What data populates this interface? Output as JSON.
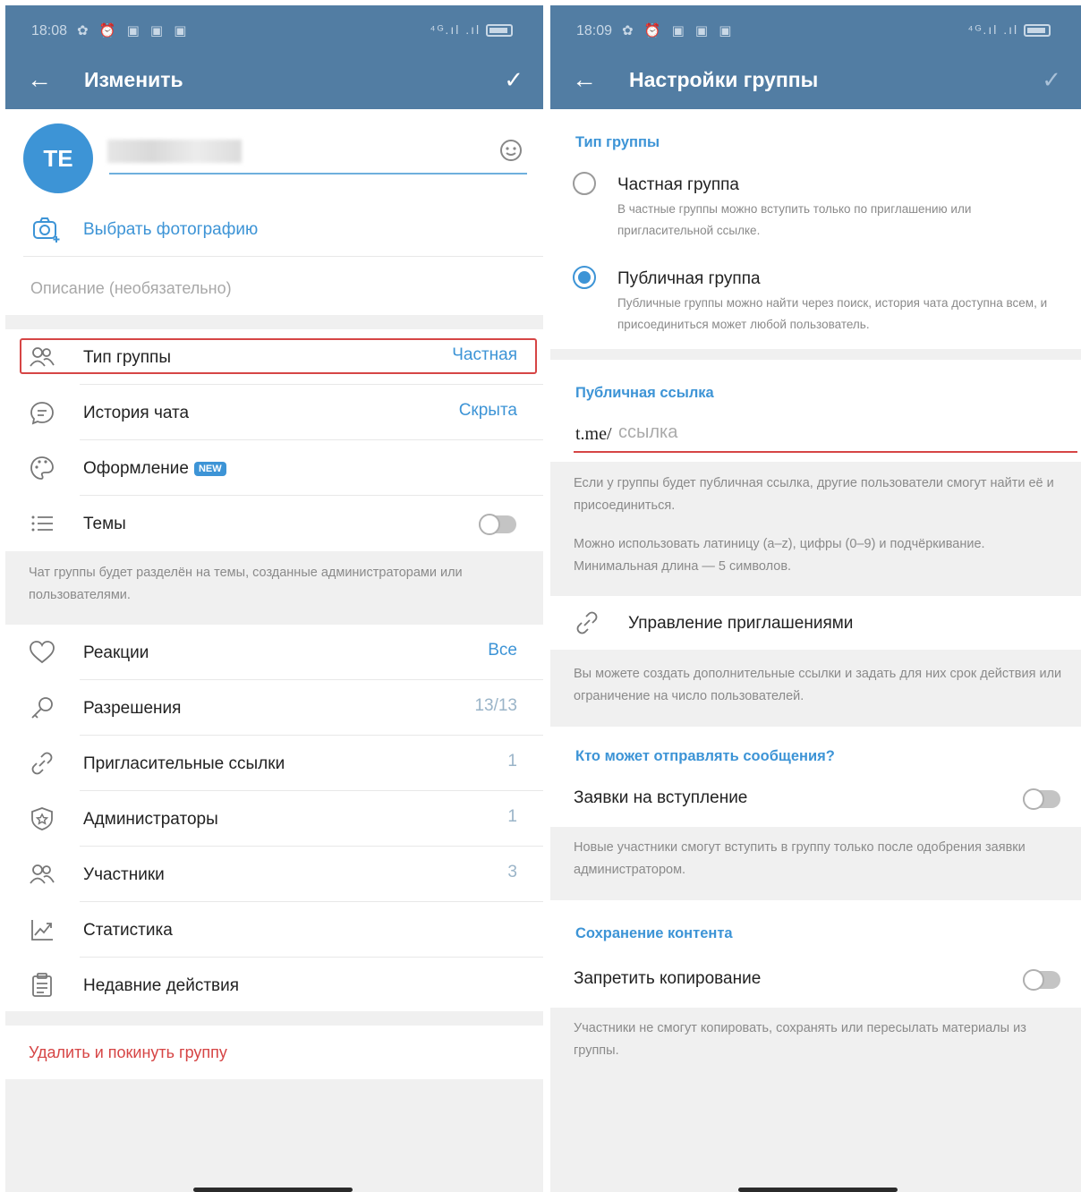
{
  "left": {
    "status": {
      "time": "18:08",
      "icons": "✿ ⏰ ▣ ▣ ▣",
      "signal": "⁴ᴳ.ıl .ıl"
    },
    "appbar": {
      "back": "←",
      "title": "Изменить",
      "check": "✓"
    },
    "avatar_initials": "TE",
    "choose_photo": "Выбрать фотографию",
    "description_placeholder": "Описание (необязательно)",
    "settings": [
      {
        "label": "Тип группы",
        "value": "Частная",
        "icon": "users-icon"
      },
      {
        "label": "История чата",
        "value": "Скрыта",
        "icon": "chat-bubble-icon"
      },
      {
        "label": "Оформление",
        "badge": "NEW",
        "icon": "palette-icon"
      },
      {
        "label": "Темы",
        "icon": "list-icon",
        "toggle": false
      }
    ],
    "topics_hint": "Чат группы будет разделён на темы, созданные администраторами или пользователями.",
    "manage": [
      {
        "label": "Реакции",
        "value": "Все",
        "icon": "heart-icon"
      },
      {
        "label": "Разрешения",
        "value": "13/13",
        "icon": "key-icon"
      },
      {
        "label": "Пригласительные ссылки",
        "value": "1",
        "icon": "link-icon"
      },
      {
        "label": "Администраторы",
        "value": "1",
        "icon": "shield-icon"
      },
      {
        "label": "Участники",
        "value": "3",
        "icon": "users-icon"
      },
      {
        "label": "Статистика",
        "icon": "chart-icon"
      },
      {
        "label": "Недавние действия",
        "icon": "clipboard-icon"
      }
    ],
    "delete_label": "Удалить и покинуть группу"
  },
  "right": {
    "status": {
      "time": "18:09",
      "icons": "✿ ⏰ ▣ ▣ ▣",
      "signal": "⁴ᴳ.ıl .ıl"
    },
    "appbar": {
      "back": "←",
      "title": "Настройки группы",
      "check": "✓"
    },
    "type_section": "Тип группы",
    "private": {
      "label": "Частная группа",
      "desc": "В частные группы можно вступить только по приглашению или пригласительной ссылке."
    },
    "public": {
      "label": "Публичная группа",
      "desc": "Публичные группы можно найти через поиск, история чата доступна всем, и присоединиться может любой пользователь."
    },
    "public_link_section": "Публичная ссылка",
    "link_prefix": "t.me/",
    "link_placeholder": "ссылка",
    "link_hint1": "Если у группы будет публичная ссылка, другие пользователи смогут найти её и присоединиться.",
    "link_hint2": "Можно использовать латиницу (a–z), цифры (0–9) и подчёркивание. Минимальная длина — 5 символов.",
    "invites_label": "Управление приглашениями",
    "invites_hint": "Вы можете создать дополнительные ссылки и задать для них срок действия или ограничение на число пользователей.",
    "who_section": "Кто может отправлять сообщения?",
    "join_requests_label": "Заявки на вступление",
    "join_requests_hint": "Новые участники смогут вступить в группу только после одобрения заявки администратором.",
    "content_section": "Сохранение контента",
    "restrict_label": "Запретить копирование",
    "restrict_hint": "Участники не смогут копировать, сохранять или пересылать материалы из группы."
  },
  "colors": {
    "header": "#527da3",
    "accent": "#3d94d6",
    "danger": "#d64545",
    "highlight": "#d64545"
  }
}
